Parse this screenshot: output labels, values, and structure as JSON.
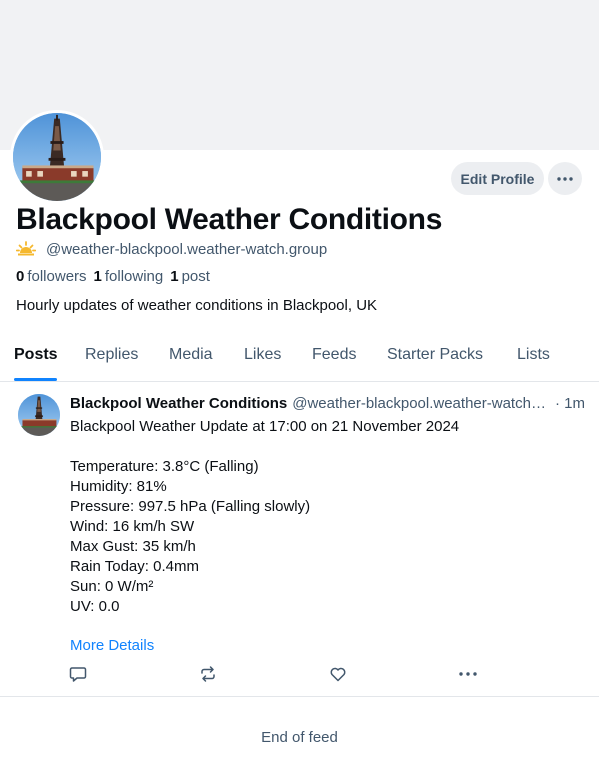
{
  "profile": {
    "display_name": "Blackpool Weather Conditions",
    "handle": "@weather-blackpool.weather-watch.group",
    "handle_icon": "sunrise-icon",
    "followers_count": "0",
    "followers_label": "followers",
    "following_count": "1",
    "following_label": "following",
    "posts_count": "1",
    "posts_label": "post",
    "bio": "Hourly updates of weather conditions in Blackpool, UK",
    "edit_profile_label": "Edit Profile",
    "more_icon": "ellipsis-icon"
  },
  "tabs": [
    {
      "label": "Posts",
      "active": true
    },
    {
      "label": "Replies"
    },
    {
      "label": "Media"
    },
    {
      "label": "Likes"
    },
    {
      "label": "Feeds"
    },
    {
      "label": "Starter Packs"
    },
    {
      "label": "Lists"
    }
  ],
  "post": {
    "author": "Blackpool Weather Conditions",
    "handle": "@weather-blackpool.weather-watch.group",
    "time": "· 1m",
    "text": "Blackpool Weather Update at 17:00 on 21 November 2024\n\nTemperature: 3.8°C (Falling)\nHumidity: 81%\nPressure: 997.5 hPa (Falling slowly)\nWind: 16 km/h SW\nMax Gust: 35 km/h\nRain Today: 0.4mm\nSun: 0 W/m²\nUV: 0.0",
    "link_label": "More Details",
    "actions": [
      "reply-icon",
      "repost-icon",
      "like-icon",
      "more-icon"
    ]
  },
  "feed": {
    "end_label": "End of feed"
  },
  "colors": {
    "accent": "#1083fe",
    "muted_text": "#42576c",
    "button_bg": "#eceef1",
    "banner_bg": "#f1f2f4"
  }
}
